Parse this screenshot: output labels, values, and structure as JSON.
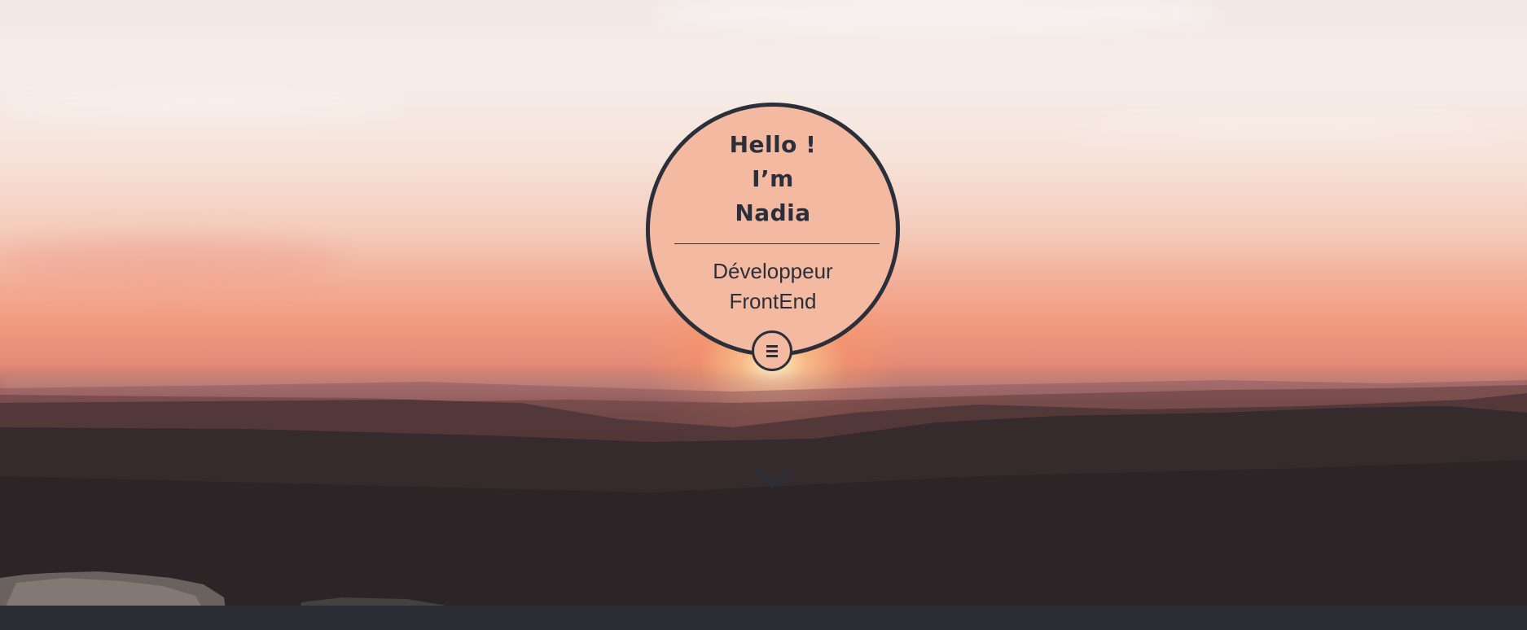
{
  "intro": {
    "greeting_line1": "Hello !",
    "greeting_line2": "I’m",
    "greeting_line3": "Nadia",
    "role_line1": "Développeur",
    "role_line2": "FrontEnd"
  },
  "icons": {
    "menu": "hamburger-icon",
    "scroll": "chevron-down-icon"
  },
  "colors": {
    "circle_fill": "#f4b9a1",
    "ink": "#2b2f3a"
  }
}
